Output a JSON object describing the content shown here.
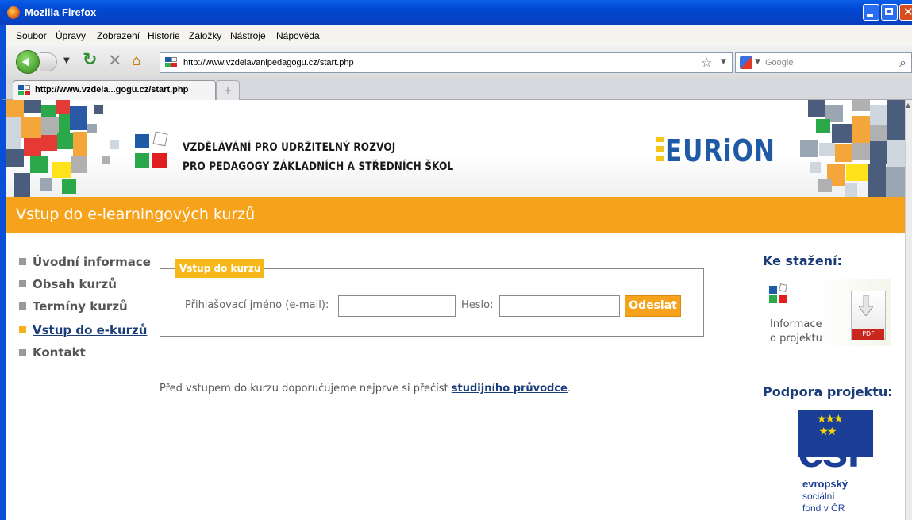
{
  "window": {
    "title": "Mozilla Firefox"
  },
  "menubar": {
    "items": [
      "Soubor",
      "Úpravy",
      "Zobrazení",
      "Historie",
      "Záložky",
      "Nástroje",
      "Nápověda"
    ]
  },
  "navbar": {
    "url": "http://www.vzdelavanipedagogu.cz/start.php",
    "search_placeholder": "Google"
  },
  "tabs": [
    {
      "label": "http://www.vzdela...gogu.cz/start.php"
    }
  ],
  "header": {
    "title_line1": "VZDĚLÁVÁNÍ PRO UDRŽITELNÝ ROZVOJ",
    "title_line2": "PRO PEDAGOGY ZÁKLADNÍCH A STŘEDNÍCH ŠKOL",
    "partner_logo": "EURiON"
  },
  "page_title": "Vstup do e-learningových kurzů",
  "nav": {
    "items": [
      {
        "label": "Úvodní informace",
        "active": false
      },
      {
        "label": "Obsah kurzů",
        "active": false
      },
      {
        "label": "Termíny kurzů",
        "active": false
      },
      {
        "label": "Vstup do e-kurzů",
        "active": true
      },
      {
        "label": "Kontakt",
        "active": false
      }
    ]
  },
  "login": {
    "legend": "Vstup do kurzu",
    "email_label": "Přihlašovací jméno (e-mail):",
    "email_value": "",
    "password_label": "Heslo:",
    "password_value": "",
    "submit_label": "Odeslat"
  },
  "notice": {
    "text": "Před vstupem do kurzu doporučujeme nejprve si přečíst ",
    "link": "studijního průvodce",
    "end": "."
  },
  "sidebar": {
    "downloads_title": "Ke stažení:",
    "info_line1": "Informace",
    "info_line2": "o projektu",
    "pdf_tag": "PDF",
    "support_title": "Podpora projektu:",
    "esf_logo": "esf",
    "esf_line1": "evropský",
    "esf_line2": "sociální",
    "esf_line3": "fond v ČR"
  },
  "colors": {
    "accent": "#f7a21b",
    "link": "#1a3d7a",
    "titlebar": "#0047d0",
    "bullet_active": "#f7b21b"
  }
}
